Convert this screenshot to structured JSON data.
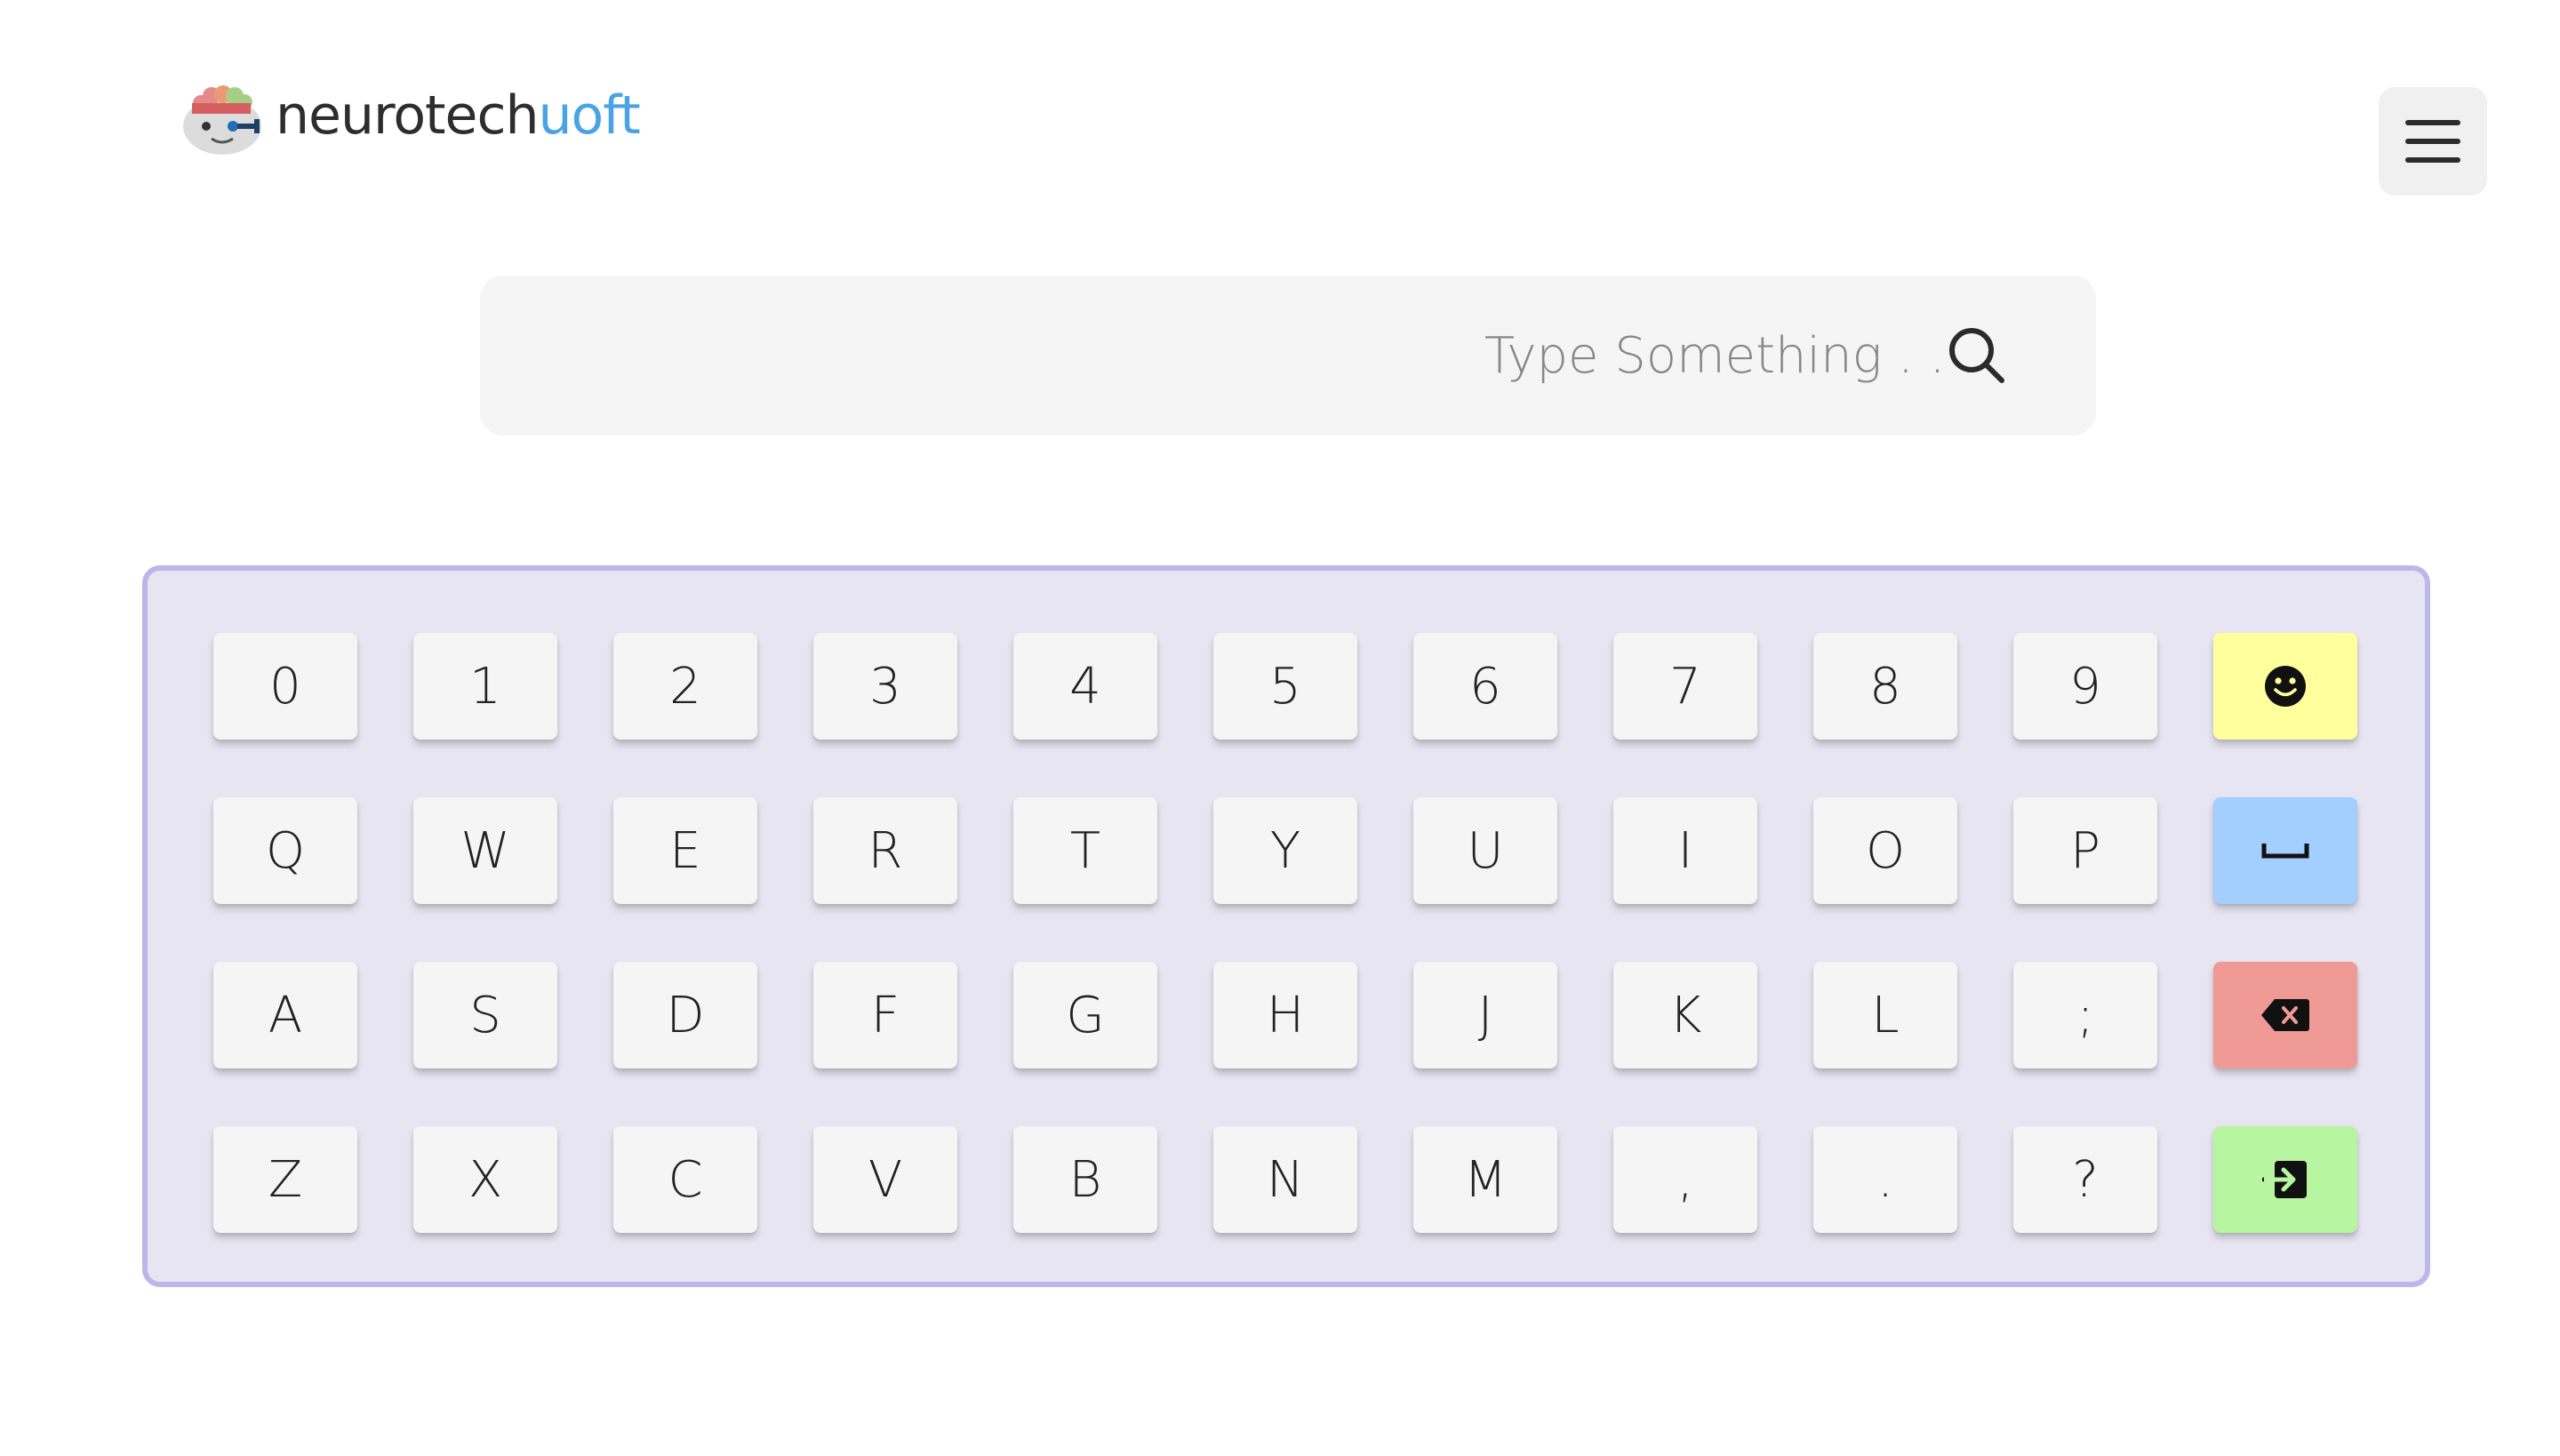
{
  "header": {
    "brand_primary": "neurotech",
    "brand_accent": "uoft"
  },
  "search": {
    "placeholder": "Type Something . . .",
    "value": ""
  },
  "keyboard": {
    "rows": [
      [
        "0",
        "1",
        "2",
        "3",
        "4",
        "5",
        "6",
        "7",
        "8",
        "9"
      ],
      [
        "Q",
        "W",
        "E",
        "R",
        "T",
        "Y",
        "U",
        "I",
        "O",
        "P"
      ],
      [
        "A",
        "S",
        "D",
        "F",
        "G",
        "H",
        "J",
        "K",
        "L",
        ";"
      ],
      [
        "Z",
        "X",
        "C",
        "V",
        "B",
        "N",
        "M",
        ",",
        ".",
        "?"
      ]
    ],
    "special_keys": [
      {
        "name": "emoji",
        "icon": "smile-icon",
        "color": "#ffff9e"
      },
      {
        "name": "space",
        "icon": "space-bar-icon",
        "color": "#a2cffe"
      },
      {
        "name": "backspace",
        "icon": "backspace-icon",
        "color": "#f09a96"
      },
      {
        "name": "enter",
        "icon": "enter-icon",
        "color": "#b8f5a0"
      }
    ]
  },
  "colors": {
    "brand_accent": "#4aa3e4",
    "keyboard_background": "#e7e5f1",
    "keyboard_border": "#bdb6ea",
    "key_background": "#f5f5f5",
    "search_background": "#f5f5f5"
  }
}
